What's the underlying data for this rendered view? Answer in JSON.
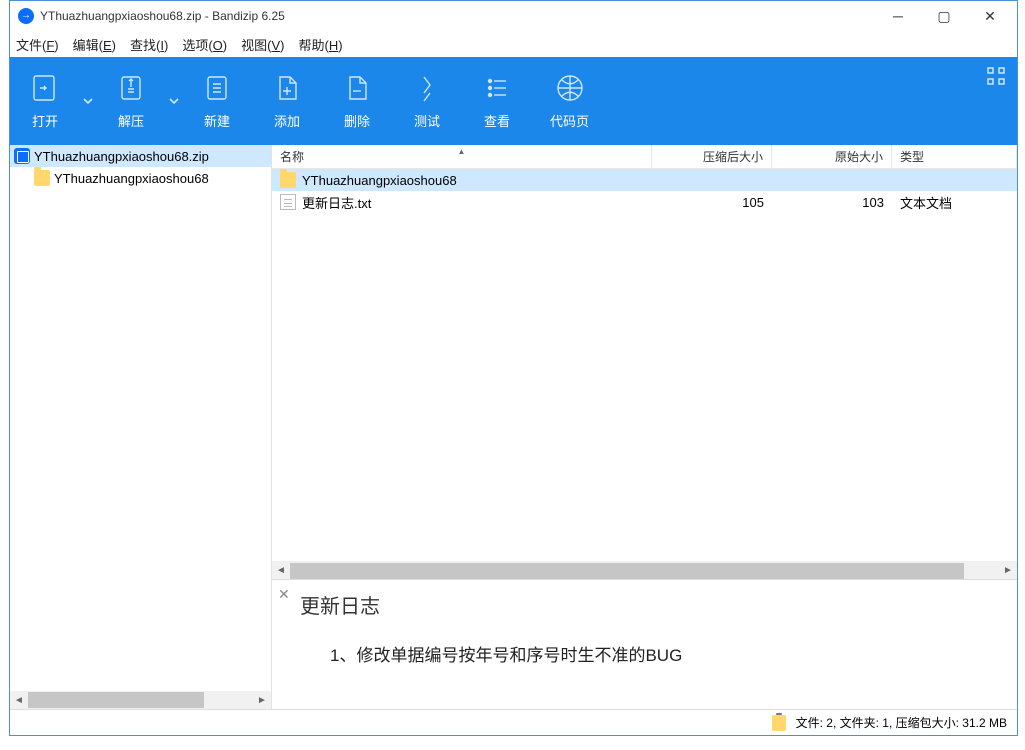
{
  "window": {
    "title": "YThuazhuangpxiaoshou68.zip - Bandizip 6.25"
  },
  "menu": {
    "file": "文件(<u>F</u>)",
    "edit": "编辑(<u>E</u>)",
    "find": "查找(<u>I</u>)",
    "options": "选项(<u>O</u>)",
    "view": "视图(<u>V</u>)",
    "help": "帮助(<u>H</u>)"
  },
  "toolbar": {
    "open": "打开",
    "extract": "解压",
    "new": "新建",
    "add": "添加",
    "delete": "删除",
    "test": "测试",
    "view": "查看",
    "codepage": "代码页"
  },
  "tree": {
    "root": "YThuazhuangpxiaoshou68.zip",
    "child": "YThuazhuangpxiaoshou68"
  },
  "columns": {
    "name": "名称",
    "compressed": "压缩后大小",
    "original": "原始大小",
    "type": "类型"
  },
  "rows": [
    {
      "name": "YThuazhuangpxiaoshou68",
      "compressed": "",
      "original": "",
      "type": "",
      "kind": "folder",
      "selected": true
    },
    {
      "name": "更新日志.txt",
      "compressed": "105",
      "original": "103",
      "type": "文本文档",
      "kind": "txt",
      "selected": false
    }
  ],
  "preview": {
    "title": "更新日志",
    "line1": "1、修改单据编号按年号和序号时生不准的BUG"
  },
  "status": {
    "text": "文件: 2, 文件夹: 1, 压缩包大小: 31.2 MB"
  }
}
